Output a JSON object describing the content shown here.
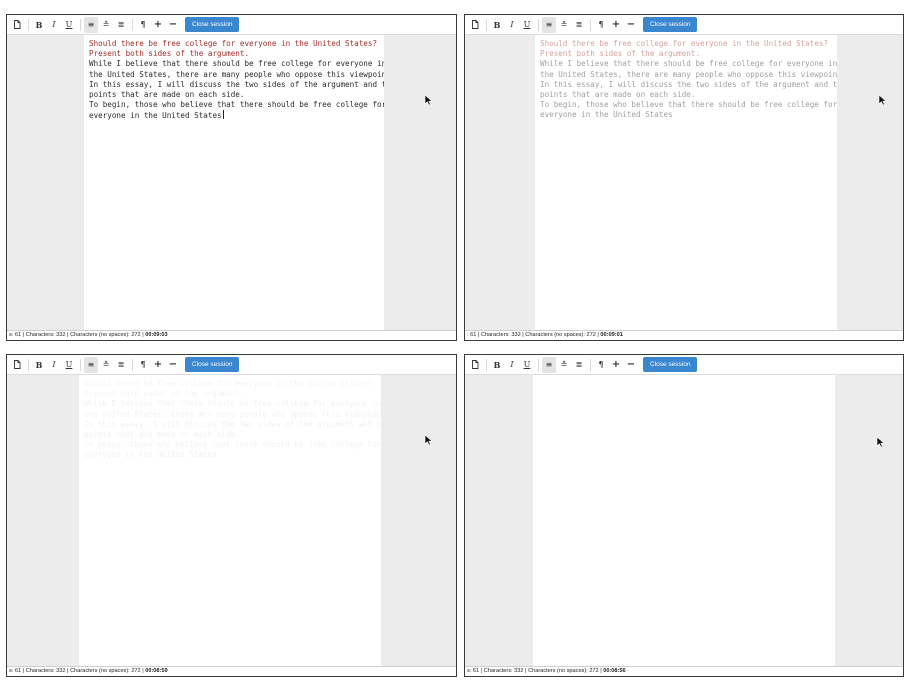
{
  "colors": {
    "close_button": "#3a86cf",
    "prompt_text": "#a0302e",
    "body_text": "#2c2c2c",
    "margin_bg": "#ececec"
  },
  "toolbar": {
    "copy_icon": "document-icon",
    "bold": "B",
    "italic": "I",
    "underline": "U",
    "align_left": "≡",
    "align_center": "≛",
    "align_justify": "≣",
    "paragraph": "¶",
    "plus": "+",
    "minus": "−",
    "close_session": "Close session"
  },
  "editor": {
    "prompt_lines": [
      "Should there be free college for everyone in the United States?",
      "Present both sides of the argument."
    ],
    "body_lines": [
      "While I believe that there should be free college for everyone in",
      "the United States, there are many people who oppose this viewpoint.",
      "In this essay, I will discuss the two sides of the argument and the",
      "points that are made on each side.",
      "To begin, those who believe that there should be free college for",
      "everyone in the United States"
    ]
  },
  "panels": [
    {
      "id": "top-left",
      "text_opacity": "full",
      "status_prefix": "s: 61",
      "characters": "Characters: 332",
      "chars_no_spaces": "Characters (no spaces): 272",
      "timer": "00:09:03"
    },
    {
      "id": "top-right",
      "text_opacity": "faded",
      "status_prefix": ": 61",
      "characters": "Characters: 332",
      "chars_no_spaces": "Characters (no spaces): 272",
      "timer": "00:09:01"
    },
    {
      "id": "bottom-left",
      "text_opacity": "ghost",
      "status_prefix": "s: 61",
      "characters": "Characters: 332",
      "chars_no_spaces": "Characters (no spaces): 272",
      "timer": "00:08:59"
    },
    {
      "id": "bottom-right",
      "text_opacity": "hidden",
      "status_prefix": "s: 61",
      "characters": "Characters: 332",
      "chars_no_spaces": "Characters (no spaces): 272",
      "timer": "00:08:56"
    }
  ]
}
